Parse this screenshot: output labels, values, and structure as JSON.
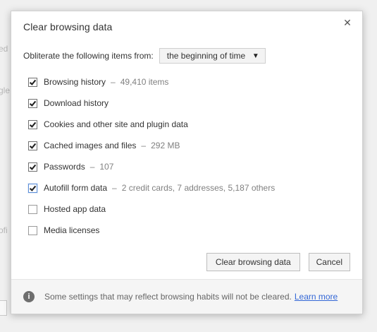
{
  "dialog": {
    "title": "Clear browsing data",
    "close_glyph": "✕"
  },
  "obliterate": {
    "label": "Obliterate the following items from:",
    "selected": "the beginning of time"
  },
  "items": [
    {
      "label": "Browsing history",
      "detail": "49,410 items",
      "checked": true
    },
    {
      "label": "Download history",
      "detail": "",
      "checked": true
    },
    {
      "label": "Cookies and other site and plugin data",
      "detail": "",
      "checked": true
    },
    {
      "label": "Cached images and files",
      "detail": "292 MB",
      "checked": true
    },
    {
      "label": "Passwords",
      "detail": "107",
      "checked": true
    },
    {
      "label": "Autofill form data",
      "detail": "2 credit cards, 7 addresses, 5,187 others",
      "checked": true
    },
    {
      "label": "Hosted app data",
      "detail": "",
      "checked": false
    },
    {
      "label": "Media licenses",
      "detail": "",
      "checked": false
    }
  ],
  "buttons": {
    "clear": "Clear browsing data",
    "cancel": "Cancel"
  },
  "footer": {
    "info_text": "Some settings that may reflect browsing habits will not be cleared.",
    "learn_more": "Learn more"
  },
  "background": {
    "fragments": [
      "ed",
      "gle",
      "ofi"
    ]
  },
  "colors": {
    "accent": "#3367d6",
    "checkbox_accent": "#5b8ed8",
    "muted_text": "#808080"
  },
  "icons": {
    "close": "close-icon",
    "dropdown": "chevron-down-icon",
    "info": "info-icon",
    "check": "check-icon"
  }
}
